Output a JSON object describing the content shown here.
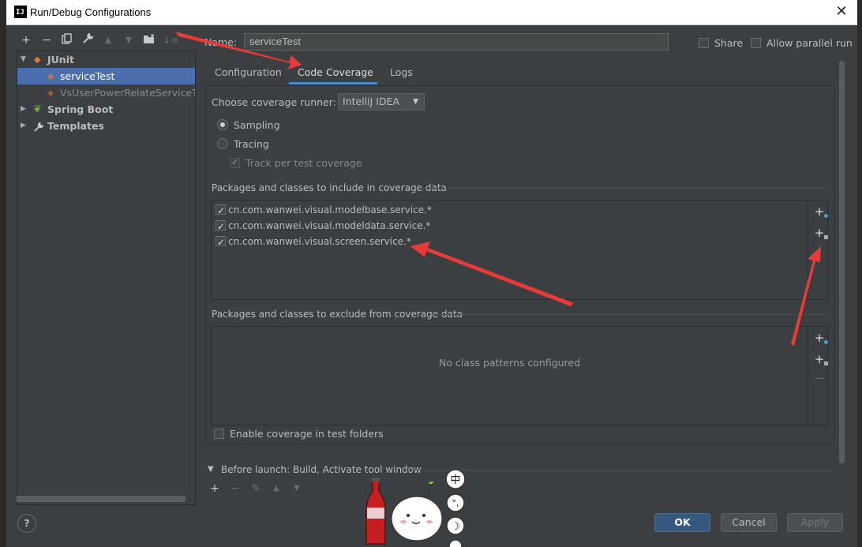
{
  "window": {
    "title": "Run/Debug Configurations",
    "logo": "IJ",
    "close": "✕"
  },
  "toolbar": {
    "icons": [
      "plus-icon",
      "minus-icon",
      "copy-icon",
      "wrench-icon",
      "arrow-up-icon",
      "arrow-down-icon",
      "folder-add-icon",
      "sort-icon"
    ]
  },
  "tree": {
    "items": [
      {
        "label": "JUnit",
        "level": 0,
        "expanded": true
      },
      {
        "label": "serviceTest",
        "level": 1,
        "selected": true
      },
      {
        "label": "VsUserPowerRelateServiceTest",
        "level": 1
      },
      {
        "label": "Spring Boot",
        "level": 0,
        "expanded": false
      },
      {
        "label": "Templates",
        "level": 0,
        "expanded": false
      }
    ]
  },
  "name_label": "Name:",
  "name_value": "serviceTest",
  "share_label": "Share",
  "parallel_label": "Allow parallel run",
  "tabs": [
    {
      "label": "Configuration"
    },
    {
      "label": "Code Coverage",
      "active": true
    },
    {
      "label": "Logs"
    }
  ],
  "coverage": {
    "runner_label": "Choose coverage runner:",
    "runner_value": "IntelliJ IDEA",
    "sampling_label": "Sampling",
    "tracing_label": "Tracing",
    "track_label": "Track per test coverage",
    "include_title": "Packages and classes to include in coverage data",
    "include_items": [
      "cn.com.wanwei.visual.modelbase.service.*",
      "cn.com.wanwei.visual.modeldata.service.*",
      "cn.com.wanwei.visual.screen.service.*"
    ],
    "exclude_title": "Packages and classes to exclude from coverage data",
    "exclude_empty": "No class patterns configured",
    "test_folders_label": "Enable coverage in test folders"
  },
  "before_launch": {
    "label": "Before launch: Build, Activate tool window"
  },
  "buttons": {
    "ok": "OK",
    "cancel": "Cancel",
    "apply": "Apply",
    "help": "?"
  },
  "sticker": {
    "text": [
      "中",
      "°,",
      "☽"
    ]
  },
  "colors": {
    "accent": "#4a88c7",
    "selection": "#4b6eaf",
    "ok": "#365880",
    "annotation": "#e83a3a"
  }
}
